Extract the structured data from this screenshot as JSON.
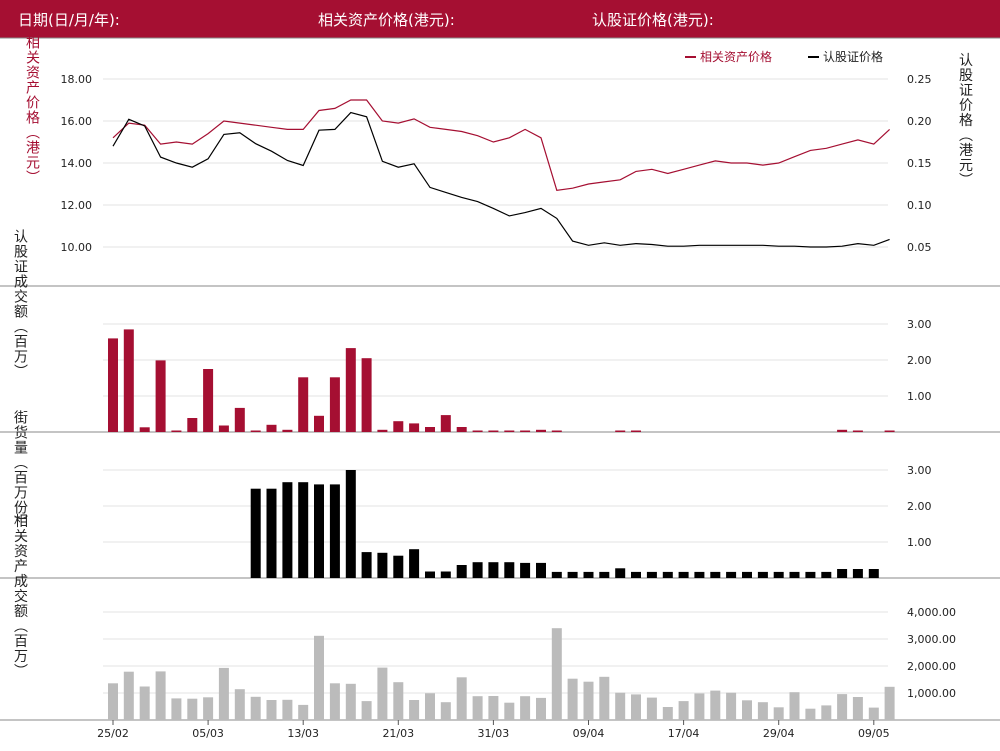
{
  "header": {
    "date_label": "日期(日/月/年):",
    "asset_price_label": "相关资产价格(港元):",
    "warrant_price_label": "认股证价格(港元):"
  },
  "colors": {
    "header_bg": "#a50f32",
    "asset": "#a50f32",
    "warrant": "#000000",
    "turnover_bar": "#a50f32",
    "outstanding_bar": "#000000",
    "asset_turnover_bar": "#bbbbbb"
  },
  "chart_data": [
    {
      "type": "line",
      "legend": [
        {
          "label": "相关资产价格",
          "color": "#a50f32"
        },
        {
          "label": "认股证价格",
          "color": "#000000"
        }
      ],
      "legend_position": "top-right",
      "ylabel_left": "相关资产价格（港元）",
      "ylabel_right": "认股证价格（港元）",
      "y_left_ticks": [
        "18.00",
        "16.00",
        "14.00",
        "12.00",
        "10.00"
      ],
      "y_left_lim": [
        8.35,
        18.5
      ],
      "y_right_ticks": [
        "0.25",
        "0.20",
        "0.15",
        "0.10",
        "0.05"
      ],
      "y_right_lim": [
        0.01,
        0.27
      ],
      "grid": true,
      "series": [
        {
          "name": "相关资产价格",
          "axis": "left",
          "values": [
            15.2,
            15.9,
            15.8,
            14.9,
            15.0,
            14.9,
            15.4,
            16.0,
            15.9,
            15.8,
            15.7,
            15.6,
            15.6,
            16.5,
            16.6,
            17.0,
            17.0,
            16.0,
            15.9,
            16.1,
            15.7,
            15.6,
            15.5,
            15.3,
            15.0,
            15.2,
            15.6,
            15.2,
            12.7,
            12.8,
            13.0,
            13.1,
            13.2,
            13.6,
            13.7,
            13.5,
            13.7,
            13.9,
            14.1,
            14.0,
            14.0,
            13.9,
            14.0,
            14.3,
            14.6,
            14.7,
            14.9,
            15.1,
            14.9,
            15.6
          ]
        },
        {
          "name": "认股证价格",
          "axis": "right",
          "values": [
            0.17,
            0.202,
            0.194,
            0.157,
            0.15,
            0.145,
            0.155,
            0.184,
            0.186,
            0.173,
            0.164,
            0.153,
            0.147,
            0.189,
            0.19,
            0.21,
            0.205,
            0.152,
            0.145,
            0.149,
            0.121,
            0.115,
            0.109,
            0.104,
            0.096,
            0.087,
            0.091,
            0.096,
            0.084,
            0.057,
            0.052,
            0.055,
            0.052,
            0.054,
            0.053,
            0.051,
            0.051,
            0.052,
            0.052,
            0.052,
            0.052,
            0.052,
            0.051,
            0.051,
            0.05,
            0.05,
            0.051,
            0.054,
            0.052,
            0.059
          ]
        }
      ]
    },
    {
      "type": "bar",
      "ylabel": "认股证成交额（百万）",
      "y_ticks": [
        "3.00",
        "2.00",
        "1.00"
      ],
      "ylim": [
        0,
        3.1
      ],
      "values": [
        2.6,
        2.85,
        0.13,
        1.99,
        0.03,
        0.39,
        1.75,
        0.18,
        0.67,
        0.02,
        0.2,
        0.06,
        1.52,
        0.45,
        1.52,
        2.33,
        2.05,
        0.06,
        0.3,
        0.24,
        0.14,
        0.47,
        0.14,
        0.03,
        0.03,
        0.02,
        0.02,
        0.06,
        0.02,
        0,
        0,
        0,
        0.02,
        0.02,
        0,
        0,
        0,
        0,
        0,
        0,
        0,
        0,
        0,
        0,
        0,
        0,
        0.06,
        0.03,
        0,
        0.03
      ]
    },
    {
      "type": "bar",
      "ylabel": "街货量（百万份）",
      "y_ticks": [
        "3.00",
        "2.00",
        "1.00"
      ],
      "ylim": [
        0,
        3.1
      ],
      "values": [
        0,
        0,
        0,
        0,
        0,
        0,
        0,
        0,
        0,
        2.48,
        2.48,
        2.66,
        2.66,
        2.6,
        2.6,
        3.0,
        0.72,
        0.7,
        0.62,
        0.8,
        0.18,
        0.18,
        0.36,
        0.44,
        0.44,
        0.44,
        0.42,
        0.42,
        0.17,
        0.17,
        0.17,
        0.17,
        0.27,
        0.17,
        0.17,
        0.17,
        0.17,
        0.17,
        0.17,
        0.17,
        0.17,
        0.17,
        0.17,
        0.17,
        0.17,
        0.17,
        0.25,
        0.25,
        0.25,
        0
      ]
    },
    {
      "type": "bar",
      "ylabel": "相关资产成交额（百万）",
      "y_ticks": [
        "4,000.00",
        "3,000.00",
        "2,000.00",
        "1,000.00"
      ],
      "ylim": [
        0,
        4400
      ],
      "values": [
        1360,
        1790,
        1240,
        1800,
        800,
        790,
        840,
        1930,
        1140,
        860,
        740,
        750,
        560,
        3120,
        1360,
        1340,
        700,
        1940,
        1400,
        740,
        990,
        660,
        1580,
        880,
        890,
        640,
        880,
        820,
        3400,
        1530,
        1420,
        1600,
        1010,
        950,
        830,
        480,
        700,
        980,
        1090,
        1010,
        730,
        660,
        470,
        1030,
        420,
        540,
        960,
        850,
        460,
        1230
      ]
    },
    {
      "type": "axis",
      "x_tick_labels": [
        "25/02",
        "05/03",
        "13/03",
        "21/03",
        "31/03",
        "09/04",
        "17/04",
        "29/04",
        "09/05"
      ]
    }
  ]
}
